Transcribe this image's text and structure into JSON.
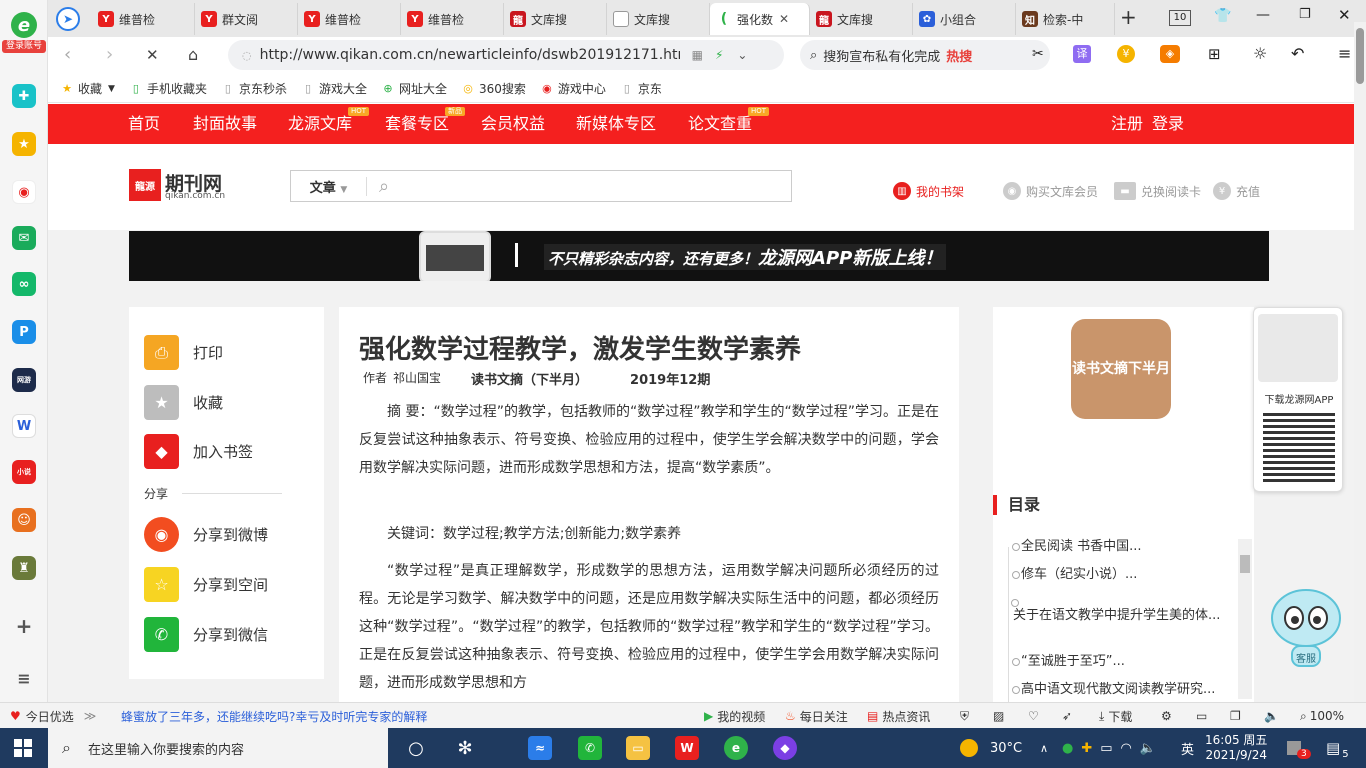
{
  "browser": {
    "login_label": "登录账号",
    "tabs": [
      {
        "label": "维普检",
        "icon": "weipu-icon",
        "color": "#e8201f"
      },
      {
        "label": "群文阅",
        "icon": "weipu-icon",
        "color": "#e8201f"
      },
      {
        "label": "维普检",
        "icon": "weipu-icon",
        "color": "#e8201f"
      },
      {
        "label": "维普检",
        "icon": "weipu-icon",
        "color": "#e8201f"
      },
      {
        "label": "文库搜",
        "icon": "longyuan-icon",
        "color": "#c9151e"
      },
      {
        "label": "文库搜",
        "icon": "page-icon",
        "color": "#888888"
      },
      {
        "label": "强化数",
        "icon": "loading-icon",
        "color": "#2fb24a"
      },
      {
        "label": "文库搜",
        "icon": "longyuan-icon",
        "color": "#c9151e"
      },
      {
        "label": "小组合",
        "icon": "baidu-paw-icon",
        "color": "#2b5fd9"
      },
      {
        "label": "检索-中",
        "icon": "zhiwang-icon",
        "color": "#6b3a1e"
      }
    ],
    "tab_count": "10",
    "url": "http://www.qikan.com.cn/newarticleinfo/dswb201912171.htm",
    "search_hint": "搜狗宣布私有化完成",
    "hot_label": "热搜",
    "bookmarks": [
      "收藏",
      "手机收藏夹",
      "京东秒杀",
      "游戏大全",
      "网址大全",
      "360搜索",
      "游戏中心",
      "京东"
    ]
  },
  "site": {
    "nav": [
      "首页",
      "封面故事",
      "龙源文库",
      "套餐专区",
      "会员权益",
      "新媒体专区",
      "论文查重"
    ],
    "nav_badge": "HOT",
    "nav_badge2": "新品",
    "register": "注册",
    "login": "登录",
    "logo_mark": "龍源",
    "logo_name": "期刊网",
    "logo_domain": "qikan.com.cn",
    "search_category": "文章",
    "my_shelf": "我的书架",
    "buy_vip": "购买文库会员",
    "redeem": "兑换阅读卡",
    "recharge": "充值",
    "banner_text": "不只精彩杂志内容，还有更多！",
    "banner_text2": "龙源网APP新版上线！"
  },
  "left_panel": {
    "print": "打印",
    "favorite": "收藏",
    "bookmark": "加入书签",
    "share": "分享",
    "weibo": "分享到微博",
    "qzone": "分享到空间",
    "wechat": "分享到微信"
  },
  "article": {
    "title": "强化数学过程教学，激发学生数学素养",
    "author_label": "作者",
    "author": "祁山国宝",
    "journal": "读书文摘（下半月）",
    "issue": "2019年12期",
    "abstract": "摘 要：“数学过程”的教学，包括教师的“数学过程”教学和学生的“数学过程”学习。正是在反复尝试这种抽象表示、符号变换、检验应用的过程中，使学生学会解决数学中的问题，学会用数学解决实际问题，进而形成数学思想和方法，提高“数学素质”。",
    "keywords": "关键词：数学过程;教学方法;创新能力;数学素养",
    "body": "“数学过程”是真正理解数学，形成数学的思想方法，运用数学解决问题所必须经历的过程。无论是学习数学、解决数学中的问题，还是应用数学解决实际生活中的问题，都必须经历这种“数学过程”。“数学过程”的教学，包括教师的“数学过程”教学和学生的“数学过程”学习。正是在反复尝试这种抽象表示、符号变换、检验应用的过程中，使学生学会用数学解决实际问题，进而形成数学思想和方"
  },
  "right_panel": {
    "cover_text": "读书文摘下半月",
    "toc_title": "目录",
    "toc": [
      "全民阅读 书香中国...",
      "修车（纪实小说）...",
      "关于在语文教学中提升学生美的体...",
      "“至诚胜于至巧”...",
      "高中语文现代散文阅读教学研究..."
    ],
    "app_caption": "下载龙源网APP",
    "mascot_label": "客服"
  },
  "statusbar": {
    "today": "今日优选",
    "news": "蜂蜜放了三年多，还能继续吃吗?幸亏及时听完专家的解释",
    "video": "我的视频",
    "daily": "每日关注",
    "hotinfo": "热点资讯",
    "download": "下载",
    "zoom": "100%"
  },
  "taskbar": {
    "search_placeholder": "在这里输入你要搜索的内容",
    "weather": "30°C",
    "ime": "英",
    "time": "16:05 周五",
    "date": "2021/9/24",
    "notif_badge": "3",
    "notif_count": "5"
  }
}
